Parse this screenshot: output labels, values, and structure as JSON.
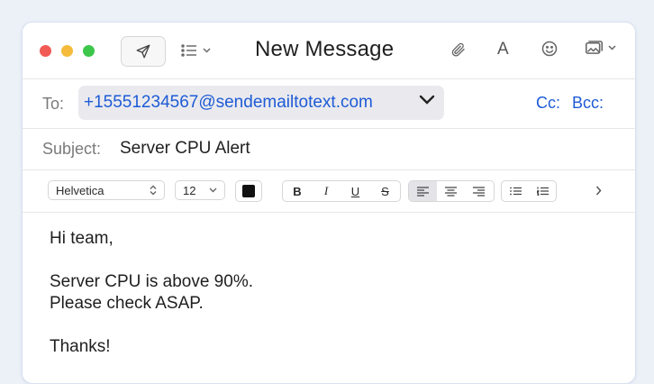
{
  "window": {
    "title": "New Message"
  },
  "header": {
    "to_label": "To:",
    "to_value": "+15551234567@sendemailtotext.com",
    "cc_label": "Cc:",
    "bcc_label": "Bcc:",
    "subject_label": "Subject:",
    "subject_value": "Server CPU Alert"
  },
  "format_bar": {
    "font_family": "Helvetica",
    "font_size": "12",
    "text_color": "#111111",
    "bold": "B",
    "italic": "I",
    "underline": "U",
    "strike": "S"
  },
  "body": {
    "lines": [
      "Hi team,",
      "",
      "Server CPU is above 90%.",
      "Please check ASAP.",
      "",
      "Thanks!"
    ]
  },
  "colors": {
    "accent": "#1e5bd6",
    "red": "#f25a55",
    "yellow": "#f5bc3c",
    "green": "#3cc74a"
  }
}
